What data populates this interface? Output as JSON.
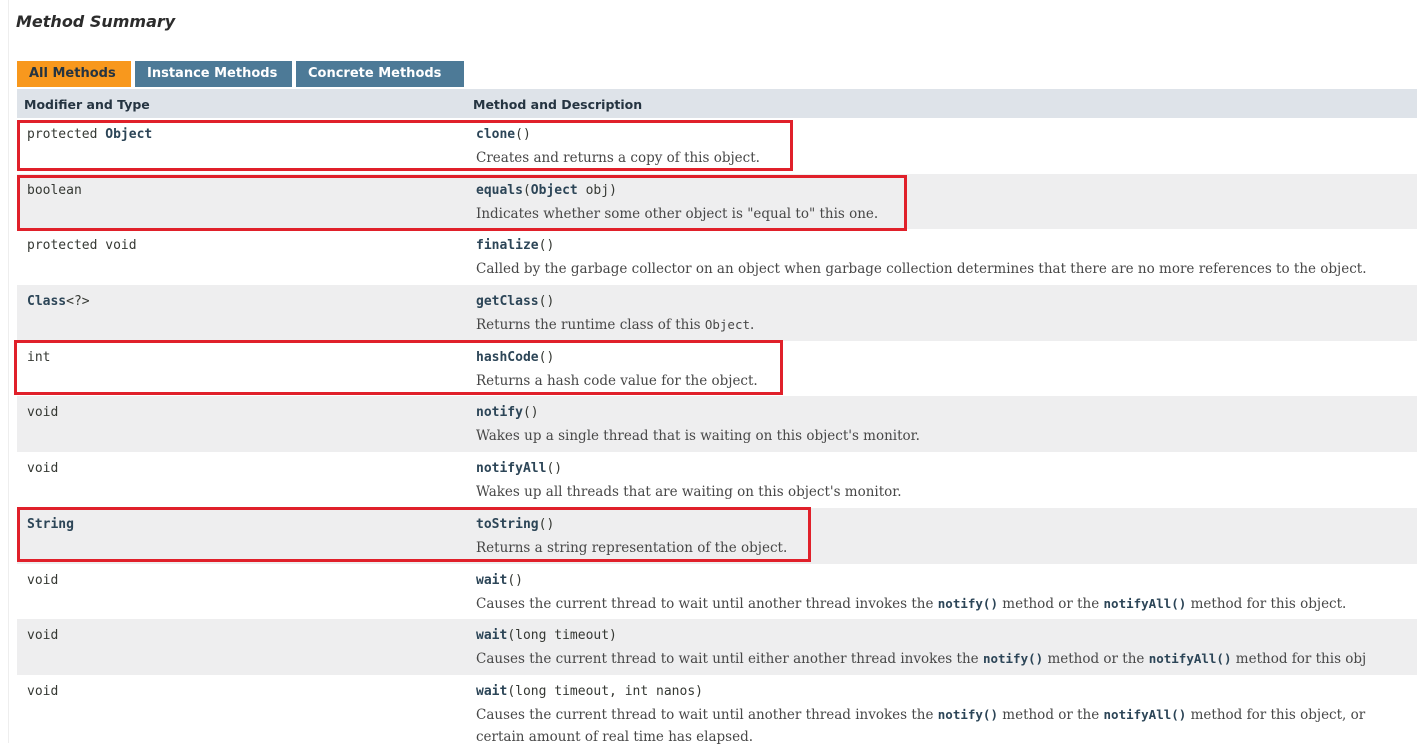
{
  "title": "Method Summary",
  "tabs": [
    {
      "label": "All Methods",
      "active": true
    },
    {
      "label": "Instance Methods",
      "active": false
    },
    {
      "label": "Concrete Methods",
      "active": false
    }
  ],
  "header": {
    "col1": "Modifier and Type",
    "col2": "Method and Description"
  },
  "rows": [
    {
      "mod_pre": "protected ",
      "mod_link": "Object",
      "mod_post": "",
      "name": "clone",
      "params_pre": "()",
      "params_link": "",
      "params_post": "",
      "desc": "Creates and returns a copy of this object."
    },
    {
      "mod_pre": "boolean",
      "mod_link": "",
      "mod_post": "",
      "name": "equals",
      "params_pre": "(",
      "params_link": "Object",
      "params_post": " obj)",
      "desc": "Indicates whether some other object is \"equal to\" this one."
    },
    {
      "mod_pre": "protected void",
      "mod_link": "",
      "mod_post": "",
      "name": "finalize",
      "params_pre": "()",
      "params_link": "",
      "params_post": "",
      "desc": "Called by the garbage collector on an object when garbage collection determines that there are no more references to the object."
    },
    {
      "mod_pre": "",
      "mod_link": "Class",
      "mod_post": "<?>",
      "name": "getClass",
      "params_pre": "()",
      "params_link": "",
      "params_post": "",
      "desc_pre": "Returns the runtime class of this ",
      "desc_code": "Object",
      "desc_post": "."
    },
    {
      "mod_pre": "int",
      "mod_link": "",
      "mod_post": "",
      "name": "hashCode",
      "params_pre": "()",
      "params_link": "",
      "params_post": "",
      "desc": "Returns a hash code value for the object."
    },
    {
      "mod_pre": "void",
      "mod_link": "",
      "mod_post": "",
      "name": "notify",
      "params_pre": "()",
      "params_link": "",
      "params_post": "",
      "desc": "Wakes up a single thread that is waiting on this object's monitor."
    },
    {
      "mod_pre": "void",
      "mod_link": "",
      "mod_post": "",
      "name": "notifyAll",
      "params_pre": "()",
      "params_link": "",
      "params_post": "",
      "desc": "Wakes up all threads that are waiting on this object's monitor."
    },
    {
      "mod_pre": "",
      "mod_link": "String",
      "mod_post": "",
      "name": "toString",
      "params_pre": "()",
      "params_link": "",
      "params_post": "",
      "desc": "Returns a string representation of the object."
    },
    {
      "mod_pre": "void",
      "mod_link": "",
      "mod_post": "",
      "name": "wait",
      "params_pre": "()",
      "params_link": "",
      "params_post": "",
      "desc_pre": "Causes the current thread to wait until another thread invokes the ",
      "desc_link1": "notify()",
      "desc_mid": " method or the ",
      "desc_link2": "notifyAll()",
      "desc_post": " method for this object."
    },
    {
      "mod_pre": "void",
      "mod_link": "",
      "mod_post": "",
      "name": "wait",
      "params_pre": "(long timeout)",
      "params_link": "",
      "params_post": "",
      "desc_pre": "Causes the current thread to wait until either another thread invokes the ",
      "desc_link1": "notify()",
      "desc_mid": " method or the ",
      "desc_link2": "notifyAll()",
      "desc_post": " method for this obj"
    },
    {
      "mod_pre": "void",
      "mod_link": "",
      "mod_post": "",
      "name": "wait",
      "params_pre": "(long timeout, int nanos)",
      "params_link": "",
      "params_post": "",
      "desc_pre": "Causes the current thread to wait until another thread invokes the ",
      "desc_link1": "notify()",
      "desc_mid": " method or the ",
      "desc_link2": "notifyAll()",
      "desc_post": " method for this object, or",
      "desc_line2": "certain amount of real time has elapsed."
    }
  ],
  "colors": {
    "active_tab": "#f8981d",
    "tab": "#4d7a97",
    "header": "#dee3e9",
    "highlight": "#e0202a",
    "link": "#2c4557"
  }
}
